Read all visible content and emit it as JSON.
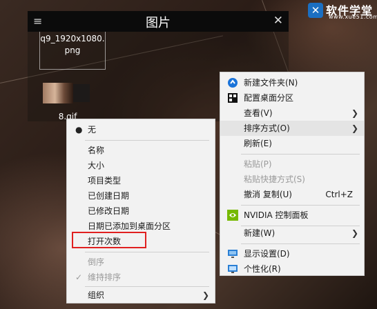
{
  "watermark": {
    "mark": "✕",
    "name": "软件学堂",
    "url": "www.xue51.com"
  },
  "fence": {
    "title": "图片",
    "menu_icon": "hamburger-icon",
    "close_icon": "close-icon",
    "file1_line1": "q9_1920x1080.",
    "file1_line2": "png",
    "file2_name": "8.gif"
  },
  "context_menu": {
    "new_folder": "新建文件夹(N)",
    "config_fences": "配置桌面分区",
    "view": "查看(V)",
    "sort_by": "排序方式(O)",
    "refresh": "刷新(E)",
    "paste": "粘贴(P)",
    "paste_shortcut": "粘贴快捷方式(S)",
    "undo_copy": "撤消 复制(U)",
    "undo_shortcut": "Ctrl+Z",
    "nvidia": "NVIDIA 控制面板",
    "new": "新建(W)",
    "display": "显示设置(D)",
    "personalize": "个性化(R)"
  },
  "sort_submenu": {
    "none": "无",
    "name": "名称",
    "size": "大小",
    "item_type": "项目类型",
    "created": "已创建日期",
    "modified": "已修改日期",
    "added": "日期已添加到桌面分区",
    "open_count": "打开次数",
    "descending": "倒序",
    "keep_sorted": "维持排序",
    "organize": "组织"
  },
  "colors": {
    "highlight_box": "#e02020",
    "menu_bg": "#f2f2f2",
    "fence_header": "#0b0b0b"
  }
}
